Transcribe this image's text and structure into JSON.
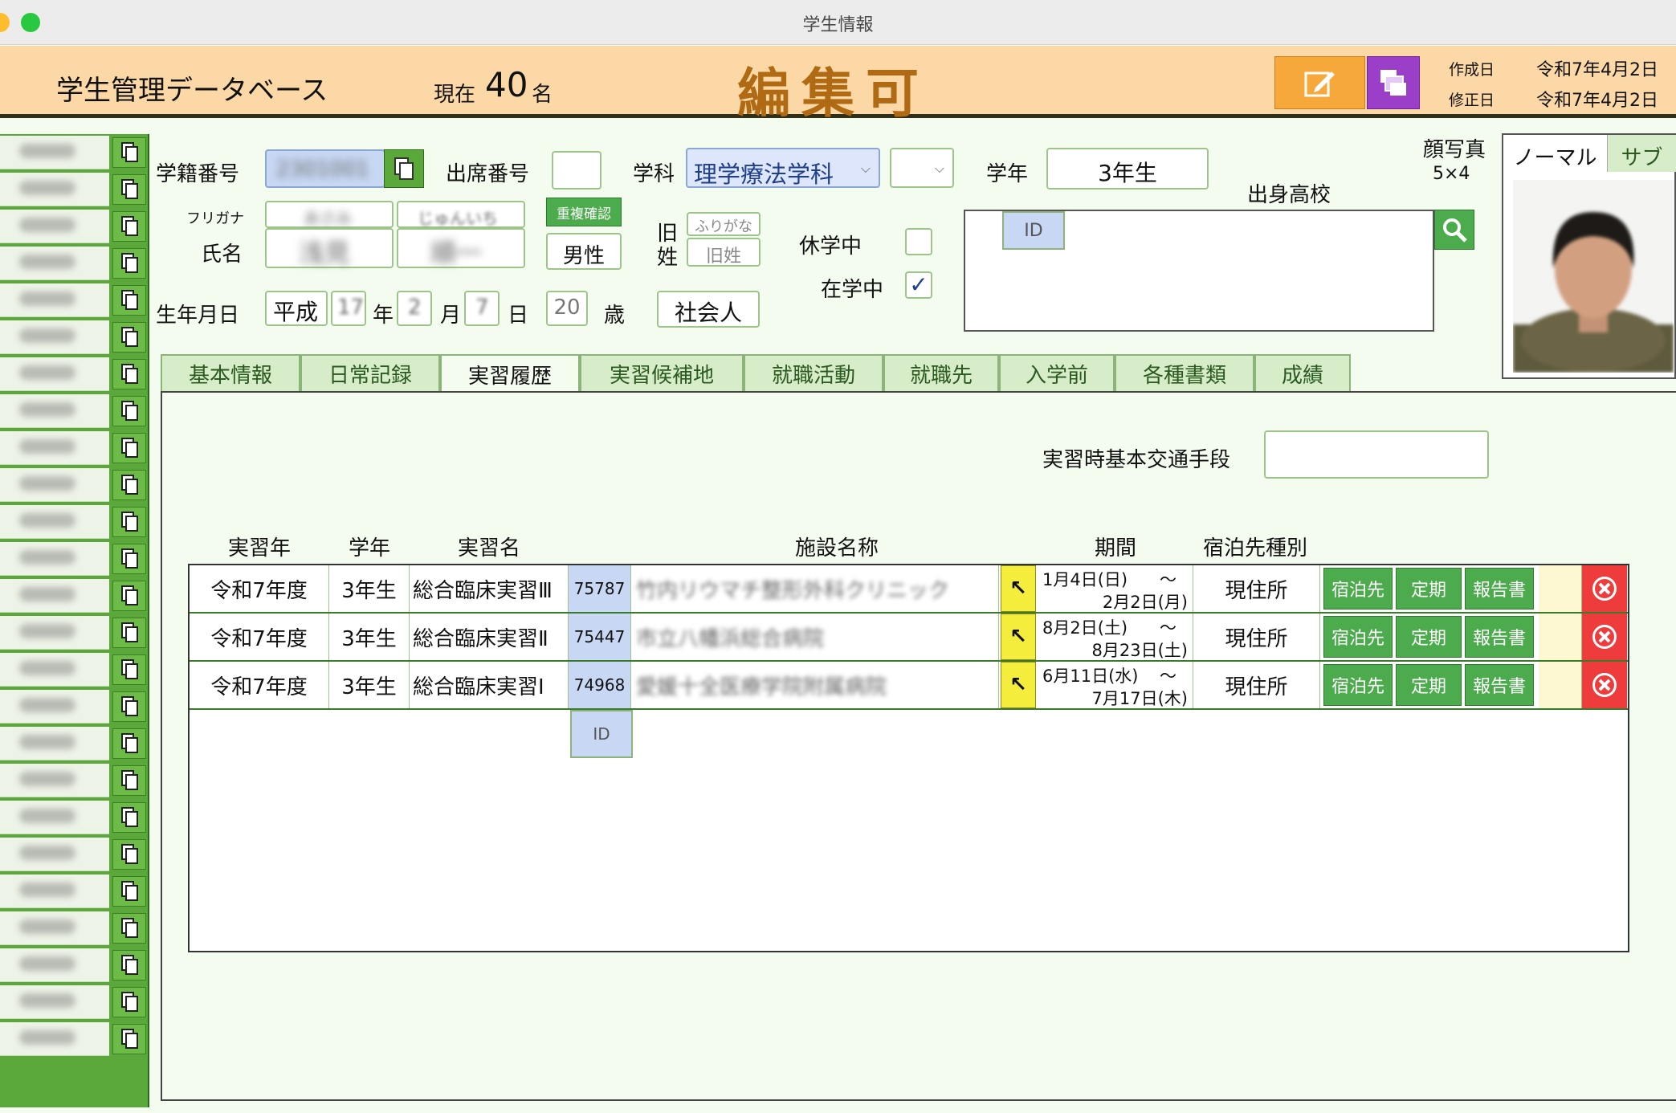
{
  "window": {
    "title": "学生情報"
  },
  "header": {
    "app_title": "学生管理データベース",
    "count_prefix": "現在",
    "count": "40",
    "count_unit": "名",
    "mode": "編集可",
    "created_label": "作成日",
    "created_value": "令和7年4月2日",
    "modified_label": "修正日",
    "modified_value": "令和7年4月2日"
  },
  "sidebar": {
    "row_count": 25
  },
  "form": {
    "student_no_label": "学籍番号",
    "student_no_value": "2301001",
    "attendance_label": "出席番号",
    "dept_label": "学科",
    "dept_value": "理学療法学科",
    "grade_label": "学年",
    "grade_value": "3年生",
    "furigana_label": "フリガナ",
    "name_label": "氏名",
    "last_kana": "あさみ",
    "first_kana": "じゅんいち",
    "last_name": "浅見",
    "first_name": "順一",
    "dup_check": "重複確認",
    "gender": "男性",
    "old_surname_label_1": "旧",
    "old_surname_label_2": "姓",
    "old_kana_placeholder": "ふりがな",
    "old_name_placeholder": "旧姓",
    "leave_label": "休学中",
    "enrolled_label": "在学中",
    "enrolled_check": "✓",
    "birth_label": "生年月日",
    "era": "平成",
    "birth_year": "17",
    "year_unit": "年",
    "birth_month": "2",
    "month_unit": "月",
    "birth_day": "7",
    "day_unit": "日",
    "age": "20",
    "age_unit": "歳",
    "status": "社会人",
    "school_label": "出身高校",
    "school_id": "ID",
    "photo_label": "顔写真",
    "photo_size": "5×4",
    "photo_tab_normal": "ノーマル",
    "photo_tab_sub": "サブ"
  },
  "tabs": [
    "基本情報",
    "日常記録",
    "実習履歴",
    "実習候補地",
    "就職活動",
    "就職先",
    "入学前",
    "各種書類",
    "成績"
  ],
  "active_tab": 2,
  "practicum": {
    "transport_label": "実習時基本交通手段",
    "columns": [
      "実習年",
      "学年",
      "実習名",
      "施設名称",
      "期間",
      "宿泊先種別"
    ],
    "rows": [
      {
        "year": "令和7年度",
        "grade": "3年生",
        "name": "総合臨床実習Ⅲ",
        "id": "75787",
        "facility": "竹内リウマチ整形外科クリニック",
        "arrow": "↖",
        "start": "1月4日(日)",
        "tilde": "〜",
        "end": "2月2日(月)",
        "lodging": "現住所",
        "btn1": "宿泊先",
        "btn2": "定期",
        "btn3": "報告書"
      },
      {
        "year": "令和7年度",
        "grade": "3年生",
        "name": "総合臨床実習Ⅱ",
        "id": "75447",
        "facility": "市立八幡浜総合病院",
        "arrow": "↖",
        "start": "8月2日(土)",
        "tilde": "〜",
        "end": "8月23日(土)",
        "lodging": "現住所",
        "btn1": "宿泊先",
        "btn2": "定期",
        "btn3": "報告書"
      },
      {
        "year": "令和7年度",
        "grade": "3年生",
        "name": "総合臨床実習Ⅰ",
        "id": "74968",
        "facility": "愛媛十全医療学院附属病院",
        "arrow": "↖",
        "start": "6月11日(水)",
        "tilde": "〜",
        "end": "7月17日(木)",
        "lodging": "現住所",
        "btn1": "宿泊先",
        "btn2": "定期",
        "btn3": "報告書"
      }
    ],
    "new_row_id": "ID"
  },
  "colors": {
    "header_bg": "#fbd8a5",
    "mode_text": "#b06a14",
    "accent_green": "#4cab4c",
    "delete_red": "#ee3b3b"
  }
}
